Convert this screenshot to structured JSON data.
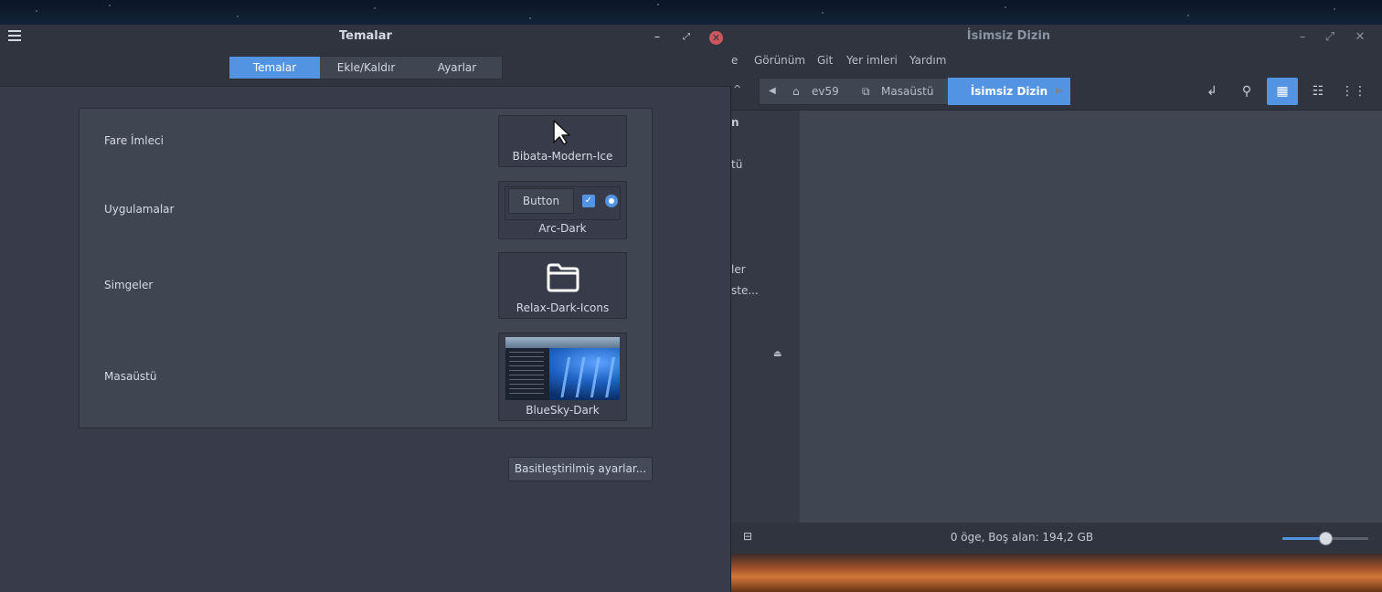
{
  "themes_window": {
    "title": "Temalar",
    "tabs": [
      {
        "label": "Temalar",
        "active": true
      },
      {
        "label": "Ekle/Kaldır",
        "active": false
      },
      {
        "label": "Ayarlar",
        "active": false
      }
    ],
    "rows": [
      {
        "label": "Fare İmleci",
        "theme": "Bibata-Modern-Ice",
        "icon": "pointer-cursor-icon"
      },
      {
        "label": "Uygulamalar",
        "theme": "Arc-Dark",
        "preview_button": "Button"
      },
      {
        "label": "Simgeler",
        "theme": "Relax-Dark-Icons",
        "icon": "folder-icon"
      },
      {
        "label": "Masaüstü",
        "theme": "BlueSky-Dark"
      }
    ],
    "simplified_button": "Basitleştirilmiş ayarlar..."
  },
  "file_manager": {
    "title": "İsimsiz Dizin",
    "menu": [
      "e",
      "Görünüm",
      "Git",
      "Yer imleri",
      "Yardım"
    ],
    "breadcrumbs": [
      "ev59",
      "Masaüstü",
      "İsimsiz Dizin"
    ],
    "sidebar_fragments": [
      "n",
      "tü",
      "ler",
      "ste..."
    ],
    "status": "0 öge, Boş alan: 194,2 GB",
    "zoom_level": 0.5
  },
  "colors": {
    "accent": "#5294e2",
    "window_bg": "#383c4a",
    "titlebar_bg": "#2f343f",
    "close": "#cc575d"
  }
}
